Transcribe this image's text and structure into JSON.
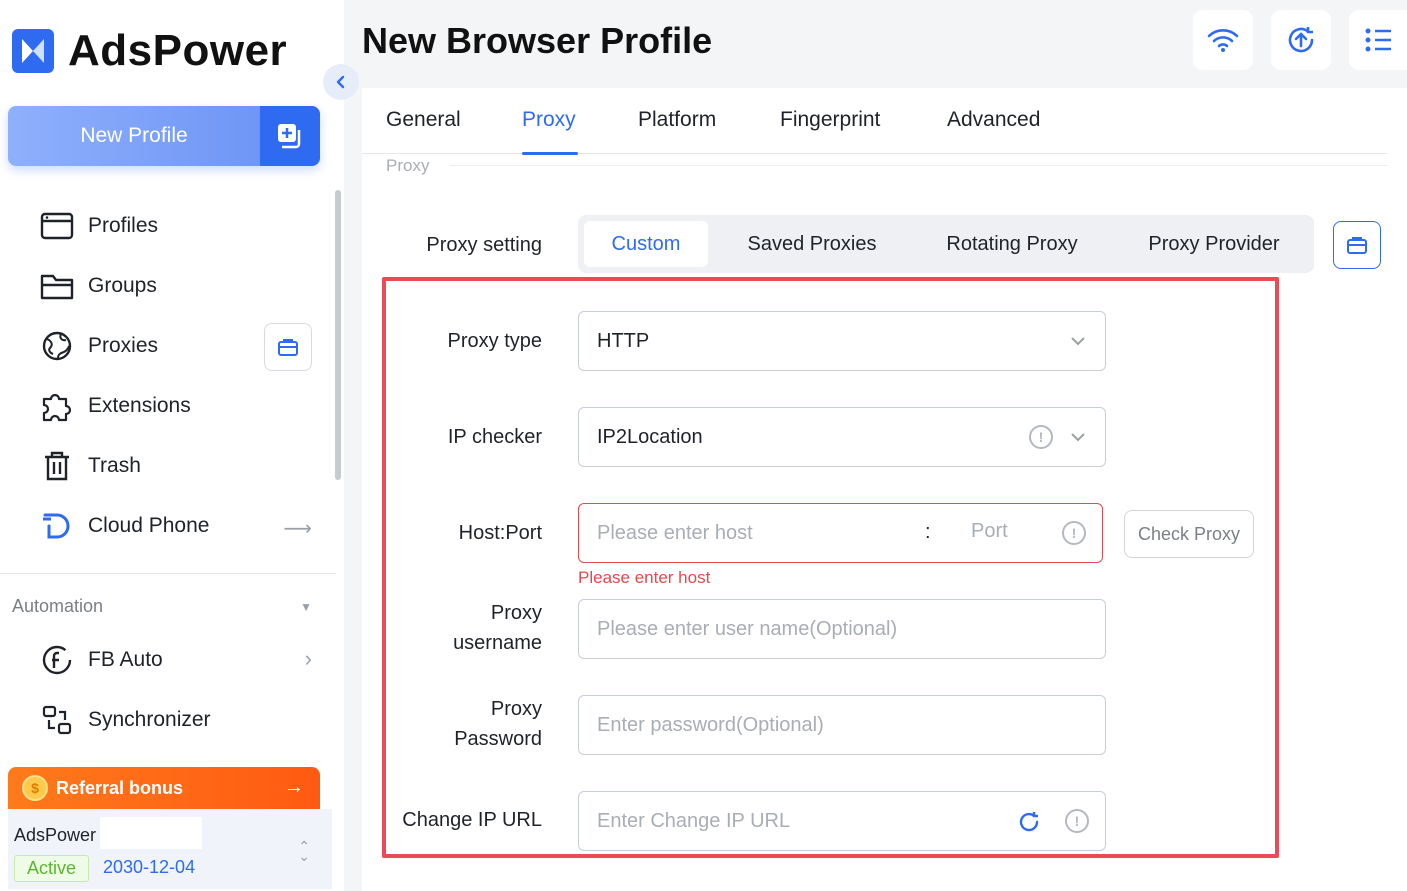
{
  "app": {
    "name": "AdsPower"
  },
  "sidebar": {
    "new_profile_label": "New Profile",
    "items": [
      {
        "label": "Profiles",
        "icon": "profiles-icon"
      },
      {
        "label": "Groups",
        "icon": "folder-icon"
      },
      {
        "label": "Proxies",
        "icon": "globe-icon"
      },
      {
        "label": "Extensions",
        "icon": "puzzle-icon"
      },
      {
        "label": "Trash",
        "icon": "trash-icon"
      },
      {
        "label": "Cloud Phone",
        "icon": "cloud-phone-icon"
      }
    ],
    "automation": {
      "heading": "Automation",
      "items": [
        {
          "label": "FB Auto",
          "icon": "facebook-icon"
        },
        {
          "label": "Synchronizer",
          "icon": "synchronizer-icon"
        }
      ]
    },
    "referral": {
      "label": "Referral bonus"
    },
    "account": {
      "name": "AdsPower",
      "status": "Active",
      "expiry": "2030-12-04"
    }
  },
  "header": {
    "title": "New Browser Profile"
  },
  "tabs": [
    {
      "label": "General"
    },
    {
      "label": "Proxy"
    },
    {
      "label": "Platform"
    },
    {
      "label": "Fingerprint"
    },
    {
      "label": "Advanced"
    }
  ],
  "active_tab": "Proxy",
  "proxy": {
    "section_label": "Proxy",
    "setting_label": "Proxy setting",
    "modes": [
      "Custom",
      "Saved Proxies",
      "Rotating Proxy",
      "Proxy Provider"
    ],
    "active_mode": "Custom",
    "type_label": "Proxy type",
    "type_value": "HTTP",
    "checker_label": "IP checker",
    "checker_value": "IP2Location",
    "host_label": "Host:Port",
    "host_placeholder": "Please enter host",
    "port_separator": ":",
    "port_placeholder": "Port",
    "host_error": "Please enter host",
    "check_button": "Check Proxy",
    "username_label_1": "Proxy",
    "username_label_2": "username",
    "username_placeholder": "Please enter user name(Optional)",
    "password_label_1": "Proxy",
    "password_label_2": "Password",
    "password_placeholder": "Enter password(Optional)",
    "change_ip_label": "Change IP URL",
    "change_ip_placeholder": "Enter Change IP URL"
  },
  "colors": {
    "accent": "#2e6bf0",
    "error": "#e5484d",
    "highlight_box": "#ea4b55",
    "referral": "#ff6a15"
  }
}
